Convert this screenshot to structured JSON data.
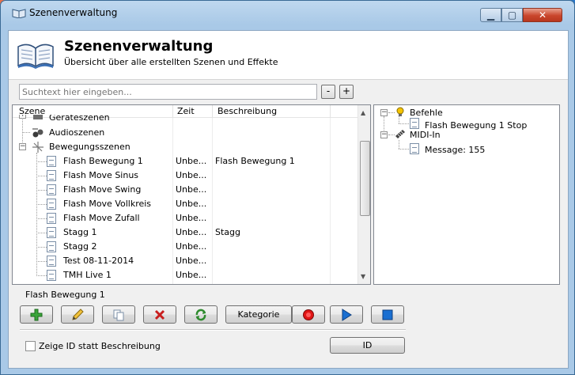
{
  "window": {
    "title": "Szenenverwaltung",
    "min": "▁",
    "max": "▢",
    "close": "✕"
  },
  "header": {
    "title": "Szenenverwaltung",
    "subtitle": "Übersicht über alle erstellten Szenen und Effekte"
  },
  "search": {
    "placeholder": "Suchtext hier eingeben...",
    "minus": "-",
    "plus": "+"
  },
  "list": {
    "columns": [
      "Szene",
      "Zeit",
      "Beschreibung"
    ],
    "categories": [
      {
        "label": "Geräteszenen",
        "icon": "devices-icon"
      },
      {
        "label": "Audioszenen",
        "icon": "audio-icon"
      },
      {
        "label": "Bewegungsszenen",
        "icon": "movement-icon"
      }
    ],
    "rows": [
      {
        "name": "Flash Bewegung 1",
        "zeit": "Unbe...",
        "beschreibung": "Flash Bewegung 1"
      },
      {
        "name": "Flash Move Sinus",
        "zeit": "Unbe...",
        "beschreibung": ""
      },
      {
        "name": "Flash Move Swing",
        "zeit": "Unbe...",
        "beschreibung": ""
      },
      {
        "name": "Flash Move Vollkreis",
        "zeit": "Unbe...",
        "beschreibung": ""
      },
      {
        "name": "Flash Move Zufall",
        "zeit": "Unbe...",
        "beschreibung": ""
      },
      {
        "name": "Stagg 1",
        "zeit": "Unbe...",
        "beschreibung": "Stagg"
      },
      {
        "name": "Stagg 2",
        "zeit": "Unbe...",
        "beschreibung": ""
      },
      {
        "name": "Test 08-11-2014",
        "zeit": "Unbe...",
        "beschreibung": ""
      },
      {
        "name": "TMH Live 1",
        "zeit": "Unbe...",
        "beschreibung": ""
      }
    ]
  },
  "tree": {
    "befehle": "Befehle",
    "befehl_item": "Flash Bewegung 1 Stop",
    "midi": "MIDI-In",
    "midi_item": "Message: 155"
  },
  "selected": "Flash Bewegung 1",
  "toolbar": {
    "kategorie": "Kategorie"
  },
  "footer": {
    "checkbox_label": "Zeige ID statt Beschreibung",
    "id_button": "ID"
  },
  "colors": {
    "add": "#2e9b2e",
    "delete": "#c81e1e",
    "record": "#e01515",
    "play": "#1a6fd1",
    "stop": "#1a6fd1"
  }
}
